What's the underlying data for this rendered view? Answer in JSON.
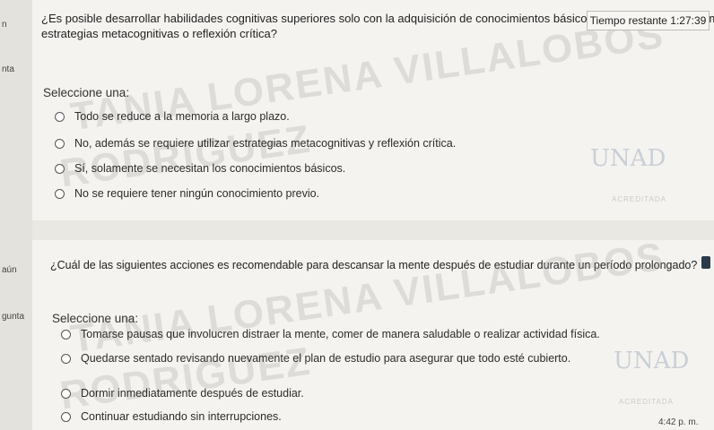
{
  "left_strip": {
    "frag1": "n",
    "frag2": "nta",
    "frag3": "aún",
    "frag4": "gunta"
  },
  "timer": {
    "label": "Tiempo restante 1:27:39"
  },
  "question1": {
    "text_line1": "¿Es posible desarrollar habilidades cognitivas superiores solo con la adquisición de conocimientos básicos, sin la necesidad de emplear",
    "text_line2": "estrategias metacognitivas o reflexión crítica?",
    "prompt": "Seleccione una:",
    "options": [
      "Todo se reduce a la memoria a largo plazo.",
      "No, además se requiere utilizar estrategias metacognitivas y reflexión crítica.",
      "Sí, solamente se necesitan los conocimientos básicos.",
      "No se requiere tener ningún conocimiento previo."
    ]
  },
  "question2": {
    "text": "¿Cuál de las siguientes acciones es recomendable para descansar la mente después de estudiar durante un período prolongado?",
    "prompt": "Seleccione una:",
    "options": [
      "Tomarse pausas que involucren distraer la mente, comer de manera saludable o realizar actividad física.",
      "Quedarse sentado revisando nuevamente el plan de estudio para asegurar que todo esté cubierto.",
      "Dormir inmediatamente después de estudiar.",
      "Continuar estudiando sin interrupciones."
    ]
  },
  "watermark": {
    "line1": "TANIA LORENA VILLALOBOS",
    "line2": "RODRIGUEZ",
    "logo": "UNAD",
    "logo_sub": "ACREDITADA"
  },
  "clock": "4:42 p. m."
}
